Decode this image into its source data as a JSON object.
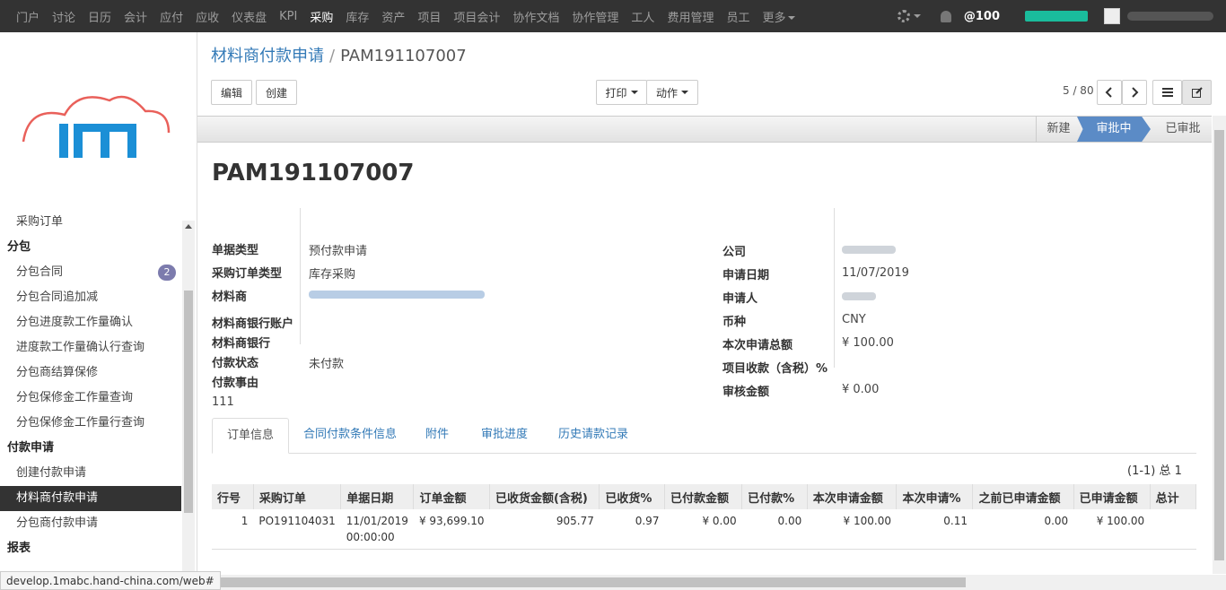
{
  "topnav": {
    "items": [
      "门户",
      "讨论",
      "日历",
      "会计",
      "应付",
      "应收",
      "仪表盘",
      "KPI",
      "采购",
      "库存",
      "资产",
      "项目",
      "项目会计",
      "协作文档",
      "协作管理",
      "工人",
      "费用管理",
      "员工",
      "更多"
    ],
    "active": "采购",
    "at_count": "@100"
  },
  "sidebar": {
    "items": [
      {
        "type": "item",
        "label": "采购订单"
      },
      {
        "type": "header",
        "label": "分包"
      },
      {
        "type": "item",
        "label": "分包合同",
        "badge": "2"
      },
      {
        "type": "item",
        "label": "分包合同追加减"
      },
      {
        "type": "item",
        "label": "分包进度款工作量确认"
      },
      {
        "type": "item",
        "label": "进度款工作量确认行查询"
      },
      {
        "type": "item",
        "label": "分包商结算保修"
      },
      {
        "type": "item",
        "label": "分包保修金工作量查询"
      },
      {
        "type": "item",
        "label": "分包保修金工作量行查询"
      },
      {
        "type": "header",
        "label": "付款申请"
      },
      {
        "type": "item",
        "label": "创建付款申请"
      },
      {
        "type": "item",
        "label": "材料商付款申请",
        "active": true
      },
      {
        "type": "item",
        "label": "分包商付款申请"
      },
      {
        "type": "header",
        "label": "报表"
      }
    ]
  },
  "status_url": "develop.1mabc.hand-china.com/web#",
  "breadcrumb": {
    "parent": "材料商付款申请",
    "separator": "/",
    "current": "PAM191107007"
  },
  "buttons": {
    "edit": "编辑",
    "create": "创建",
    "print": "打印",
    "action": "动作"
  },
  "pager": "5 / 80",
  "stages": {
    "new": "新建",
    "active": "审批中",
    "done": "已审批"
  },
  "doc_title": "PAM191107007",
  "left_fields": [
    {
      "label": "单据类型",
      "value": "预付款申请"
    },
    {
      "label": "采购订单类型",
      "value": "库存采购"
    },
    {
      "label": "材料商",
      "value": ""
    },
    {
      "label": "材料商银行账户",
      "value": ""
    },
    {
      "label": "材料商银行",
      "value": ""
    },
    {
      "label": "付款状态",
      "value": "未付款"
    }
  ],
  "right_fields": [
    {
      "label": "公司",
      "value": ""
    },
    {
      "label": "申请日期",
      "value": "11/07/2019"
    },
    {
      "label": "申请人",
      "value": ""
    },
    {
      "label": "币种",
      "value": "CNY"
    },
    {
      "label": "本次申请总额",
      "value": "¥ 100.00"
    },
    {
      "label": "项目收款（含税）%",
      "value": ""
    },
    {
      "label": "审核金额",
      "value": "¥ 0.00"
    }
  ],
  "reason": {
    "label": "付款事由",
    "value": "111"
  },
  "tabs": [
    "订单信息",
    "合同付款条件信息",
    "附件",
    "审批进度",
    "历史请款记录"
  ],
  "record_count": "(1-1) 总 1",
  "table": {
    "headers": [
      "行号",
      "采购订单",
      "单据日期",
      "订单金额",
      "已收货金额(含税)",
      "已收货%",
      "已付款金额",
      "已付款%",
      "本次申请金额",
      "本次申请%",
      "之前已申请金额",
      "已申请金额",
      "总计"
    ],
    "row": {
      "line_no": "1",
      "po": "PO191104031",
      "date1": "11/01/2019",
      "date2": "00:00:00",
      "order_amount": "¥ 93,699.10",
      "received_amount": "905.77",
      "received_pct": "0.97",
      "paid_amount": "¥ 0.00",
      "paid_pct": "0.00",
      "apply_amount": "¥ 100.00",
      "apply_pct": "0.11",
      "prev_applied": "0.00",
      "applied_amount": "¥ 100.00"
    }
  },
  "colors": {
    "stage_active": "#5b8bc6",
    "badge": "#7c7bad",
    "link": "#337ab7",
    "navbar": "#333333",
    "progress": "#1abc9c"
  }
}
